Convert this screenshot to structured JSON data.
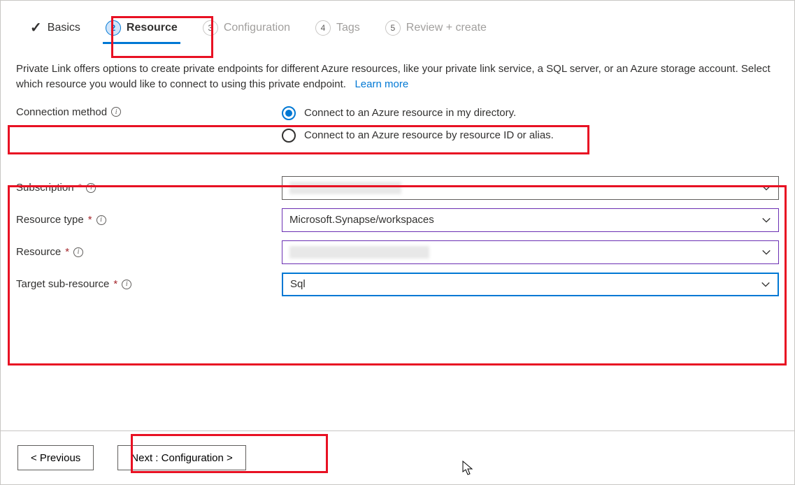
{
  "tabs": {
    "basics": {
      "label": "Basics"
    },
    "resource": {
      "num": "2",
      "label": "Resource"
    },
    "configuration": {
      "num": "3",
      "label": "Configuration"
    },
    "tags": {
      "num": "4",
      "label": "Tags"
    },
    "review": {
      "num": "5",
      "label": "Review + create"
    }
  },
  "description": "Private Link offers options to create private endpoints for different Azure resources, like your private link service, a SQL server, or an Azure storage account. Select which resource you would like to connect to using this private endpoint.",
  "learn_more": "Learn more",
  "connection_method": {
    "label": "Connection method",
    "option1": "Connect to an Azure resource in my directory.",
    "option2": "Connect to an Azure resource by resource ID or alias."
  },
  "fields": {
    "subscription": {
      "label": "Subscription",
      "value": ""
    },
    "resource_type": {
      "label": "Resource type",
      "value": "Microsoft.Synapse/workspaces"
    },
    "resource": {
      "label": "Resource",
      "value": ""
    },
    "target_sub_resource": {
      "label": "Target sub-resource",
      "value": "Sql"
    }
  },
  "footer": {
    "previous": "< Previous",
    "next": "Next : Configuration >"
  }
}
